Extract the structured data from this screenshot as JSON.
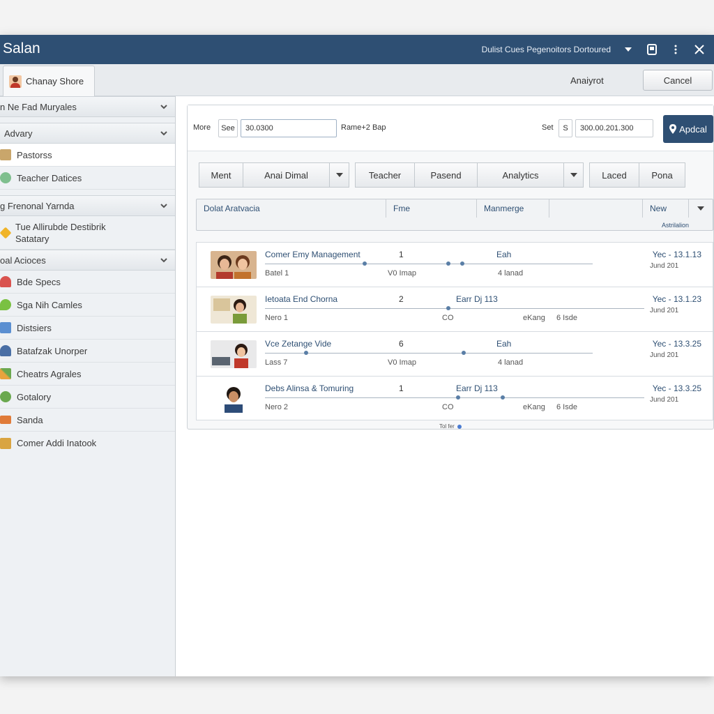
{
  "window": {
    "title": "Salan",
    "dashboard_select": "Dulist Cues Pegenoitors Dortoured"
  },
  "topstrip": {
    "user_tab": "Chanay Shore",
    "analyst_label": "Anaiyrot",
    "cancel": "Cancel"
  },
  "sidebar": {
    "section1": "n Ne Fad Muryales",
    "section2": "Advary",
    "section2_items": [
      "Pastorss",
      "Teacher Datices"
    ],
    "section3": "g Frenonal Yarnda",
    "section3_items": [
      "Tue Allirubde Destibrik Satatary"
    ],
    "section4": "oal Acioces",
    "section4_items": [
      "Bde Specs",
      "Sga Nih Camles",
      "Distsiers",
      "Batafzak Unorper",
      "Cheatrs Agrales",
      "Gotalory",
      "Sanda",
      "Comer Addi Inatook"
    ]
  },
  "filters": {
    "more_label": "More",
    "see_label": "See",
    "from_value": "30.0300",
    "range_label": "Rame+2 Bap",
    "set_label": "Set",
    "s_label": "S",
    "to_value": "300.00.201.300",
    "apply": "Apdcal"
  },
  "tabs": [
    "Ment",
    "Anai Dimal",
    "Teacher",
    "Pasend",
    "Analytics",
    "Laced",
    "Pona"
  ],
  "columns": {
    "col1": "Dolat Aratvacia",
    "col2": "Fme",
    "col3": "Manmerge",
    "col4": "New",
    "sub": "Astrilalion"
  },
  "rows": [
    {
      "title": "Comer Emy Management",
      "sub": "Batel 1",
      "num": "1",
      "mid": "V0 Imap",
      "c3": "Eah",
      "c3b": "",
      "c4": "4 lanad",
      "date": "Yec - 13.1.13",
      "date2": "Jund 201"
    },
    {
      "title": "Ietoata End Chorna",
      "sub": "Nero 1",
      "num": "2",
      "mid": "CO",
      "c3": "Earr Dj   113",
      "c3b": "eKang",
      "c4": "6 Isde",
      "date": "Yec - 13.1.23",
      "date2": "Jund 201"
    },
    {
      "title": "Vce Zetange Vide",
      "sub": "Lass 7",
      "num": "6",
      "mid": "V0 Imap",
      "c3": "Eah",
      "c3b": "",
      "c4": "4 lanad",
      "date": "Yec - 13.3.25",
      "date2": "Jund 201"
    },
    {
      "title": "Debs Alinsa & Tomuring",
      "sub": "Nero 2",
      "num": "1",
      "mid": "CO",
      "c3": "Earr Dj   113",
      "c3b": "eKang",
      "c4": "6 Isde",
      "date": "Yec - 13.3.25",
      "date2": "Jund 201"
    }
  ],
  "pager": "Tol fer"
}
